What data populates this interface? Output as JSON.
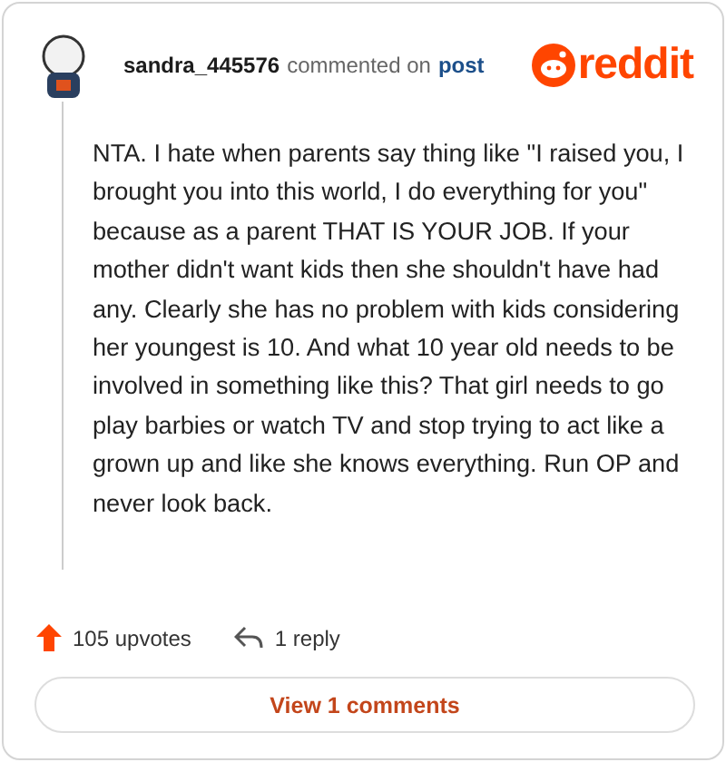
{
  "header": {
    "username": "sandra_445576",
    "action": "commented on",
    "link": "post",
    "brand": "reddit"
  },
  "comment": {
    "body": "NTA. I hate when parents say thing like \"I raised you, I brought you into this world, I do everything for you\" because as a parent THAT IS YOUR JOB. If your mother didn't want kids then she shouldn't have had any. Clearly she has no problem with kids considering her youngest is 10. And what 10 year old needs to be involved in something like this? That girl needs to go play barbies or watch TV and stop trying to act like a grown up and like she knows everything. Run OP and never look back."
  },
  "footer": {
    "upvotes": "105 upvotes",
    "replies": "1 reply"
  },
  "button": {
    "label": "View 1 comments"
  }
}
